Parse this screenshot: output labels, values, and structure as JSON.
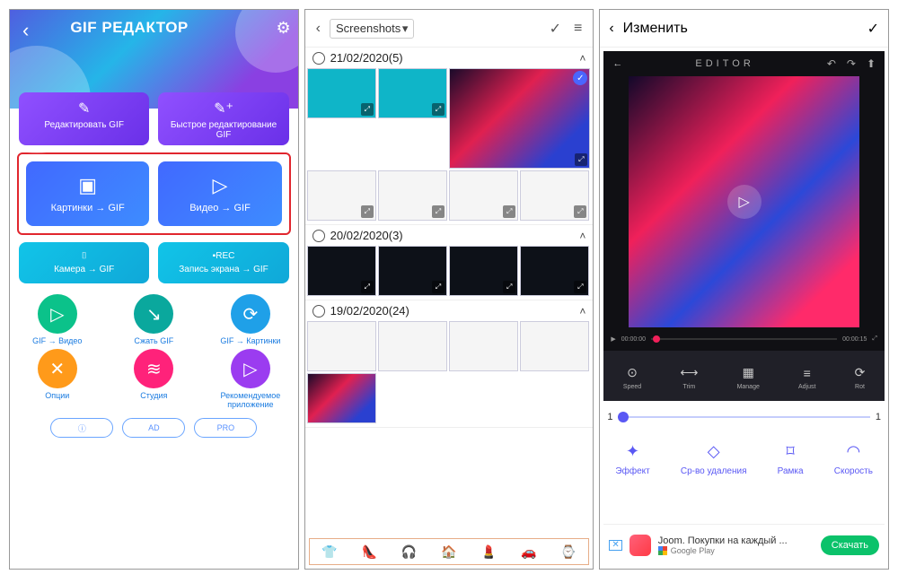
{
  "panel1": {
    "title": "GIF РЕДАКТОР",
    "purple": [
      {
        "label": "Редактировать GIF"
      },
      {
        "label": "Быстрое редактирование GIF"
      }
    ],
    "blue": [
      {
        "label": "Картинки → GIF"
      },
      {
        "label": "Видео → GIF"
      }
    ],
    "cyan": [
      {
        "label": "Камера → GIF"
      },
      {
        "label": "Запись экрана → GIF"
      }
    ],
    "circles": [
      {
        "label": "GIF → Видео",
        "color": "bg-green",
        "glyph": "▷"
      },
      {
        "label": "Сжать GIF",
        "color": "bg-teal",
        "glyph": "↘"
      },
      {
        "label": "GIF → Картинки",
        "color": "bg-blue",
        "glyph": "⟳"
      },
      {
        "label": "Опции",
        "color": "bg-orange",
        "glyph": "✕"
      },
      {
        "label": "Студия",
        "color": "bg-pink",
        "glyph": "≋"
      },
      {
        "label": "Рекомендуемое приложение",
        "color": "bg-purple",
        "glyph": "▷"
      }
    ],
    "pills": [
      "ⓘ",
      "AD",
      "PRO"
    ]
  },
  "panel2": {
    "folder": "Screenshots",
    "groups": [
      {
        "label": "21/02/2020(5)"
      },
      {
        "label": "20/02/2020(3)"
      },
      {
        "label": "19/02/2020(24)"
      }
    ],
    "emoji": [
      "👕",
      "👠",
      "🎧",
      "🏠",
      "💄",
      "🚗",
      "⌚"
    ]
  },
  "panel3": {
    "title": "Изменить",
    "editor": {
      "label": "EDITOR",
      "t0": "00:00:00",
      "t1": "00:00:15"
    },
    "edtools": [
      {
        "label": "Speed",
        "glyph": "⊙"
      },
      {
        "label": "Trim",
        "glyph": "⟷"
      },
      {
        "label": "Manage",
        "glyph": "▦"
      },
      {
        "label": "Adjust",
        "glyph": "≡"
      },
      {
        "label": "Rot",
        "glyph": "⟳"
      }
    ],
    "slider": {
      "left": "1",
      "right": "1"
    },
    "tools": [
      {
        "label": "Эффект",
        "glyph": "✦"
      },
      {
        "label": "Ср-во удаления",
        "glyph": "◇"
      },
      {
        "label": "Рамка",
        "glyph": "⌑"
      },
      {
        "label": "Скорость",
        "glyph": "◠"
      }
    ],
    "ad": {
      "title": "Joom. Покупки на каждый ...",
      "store": "Google Play",
      "cta": "Скачать"
    }
  }
}
